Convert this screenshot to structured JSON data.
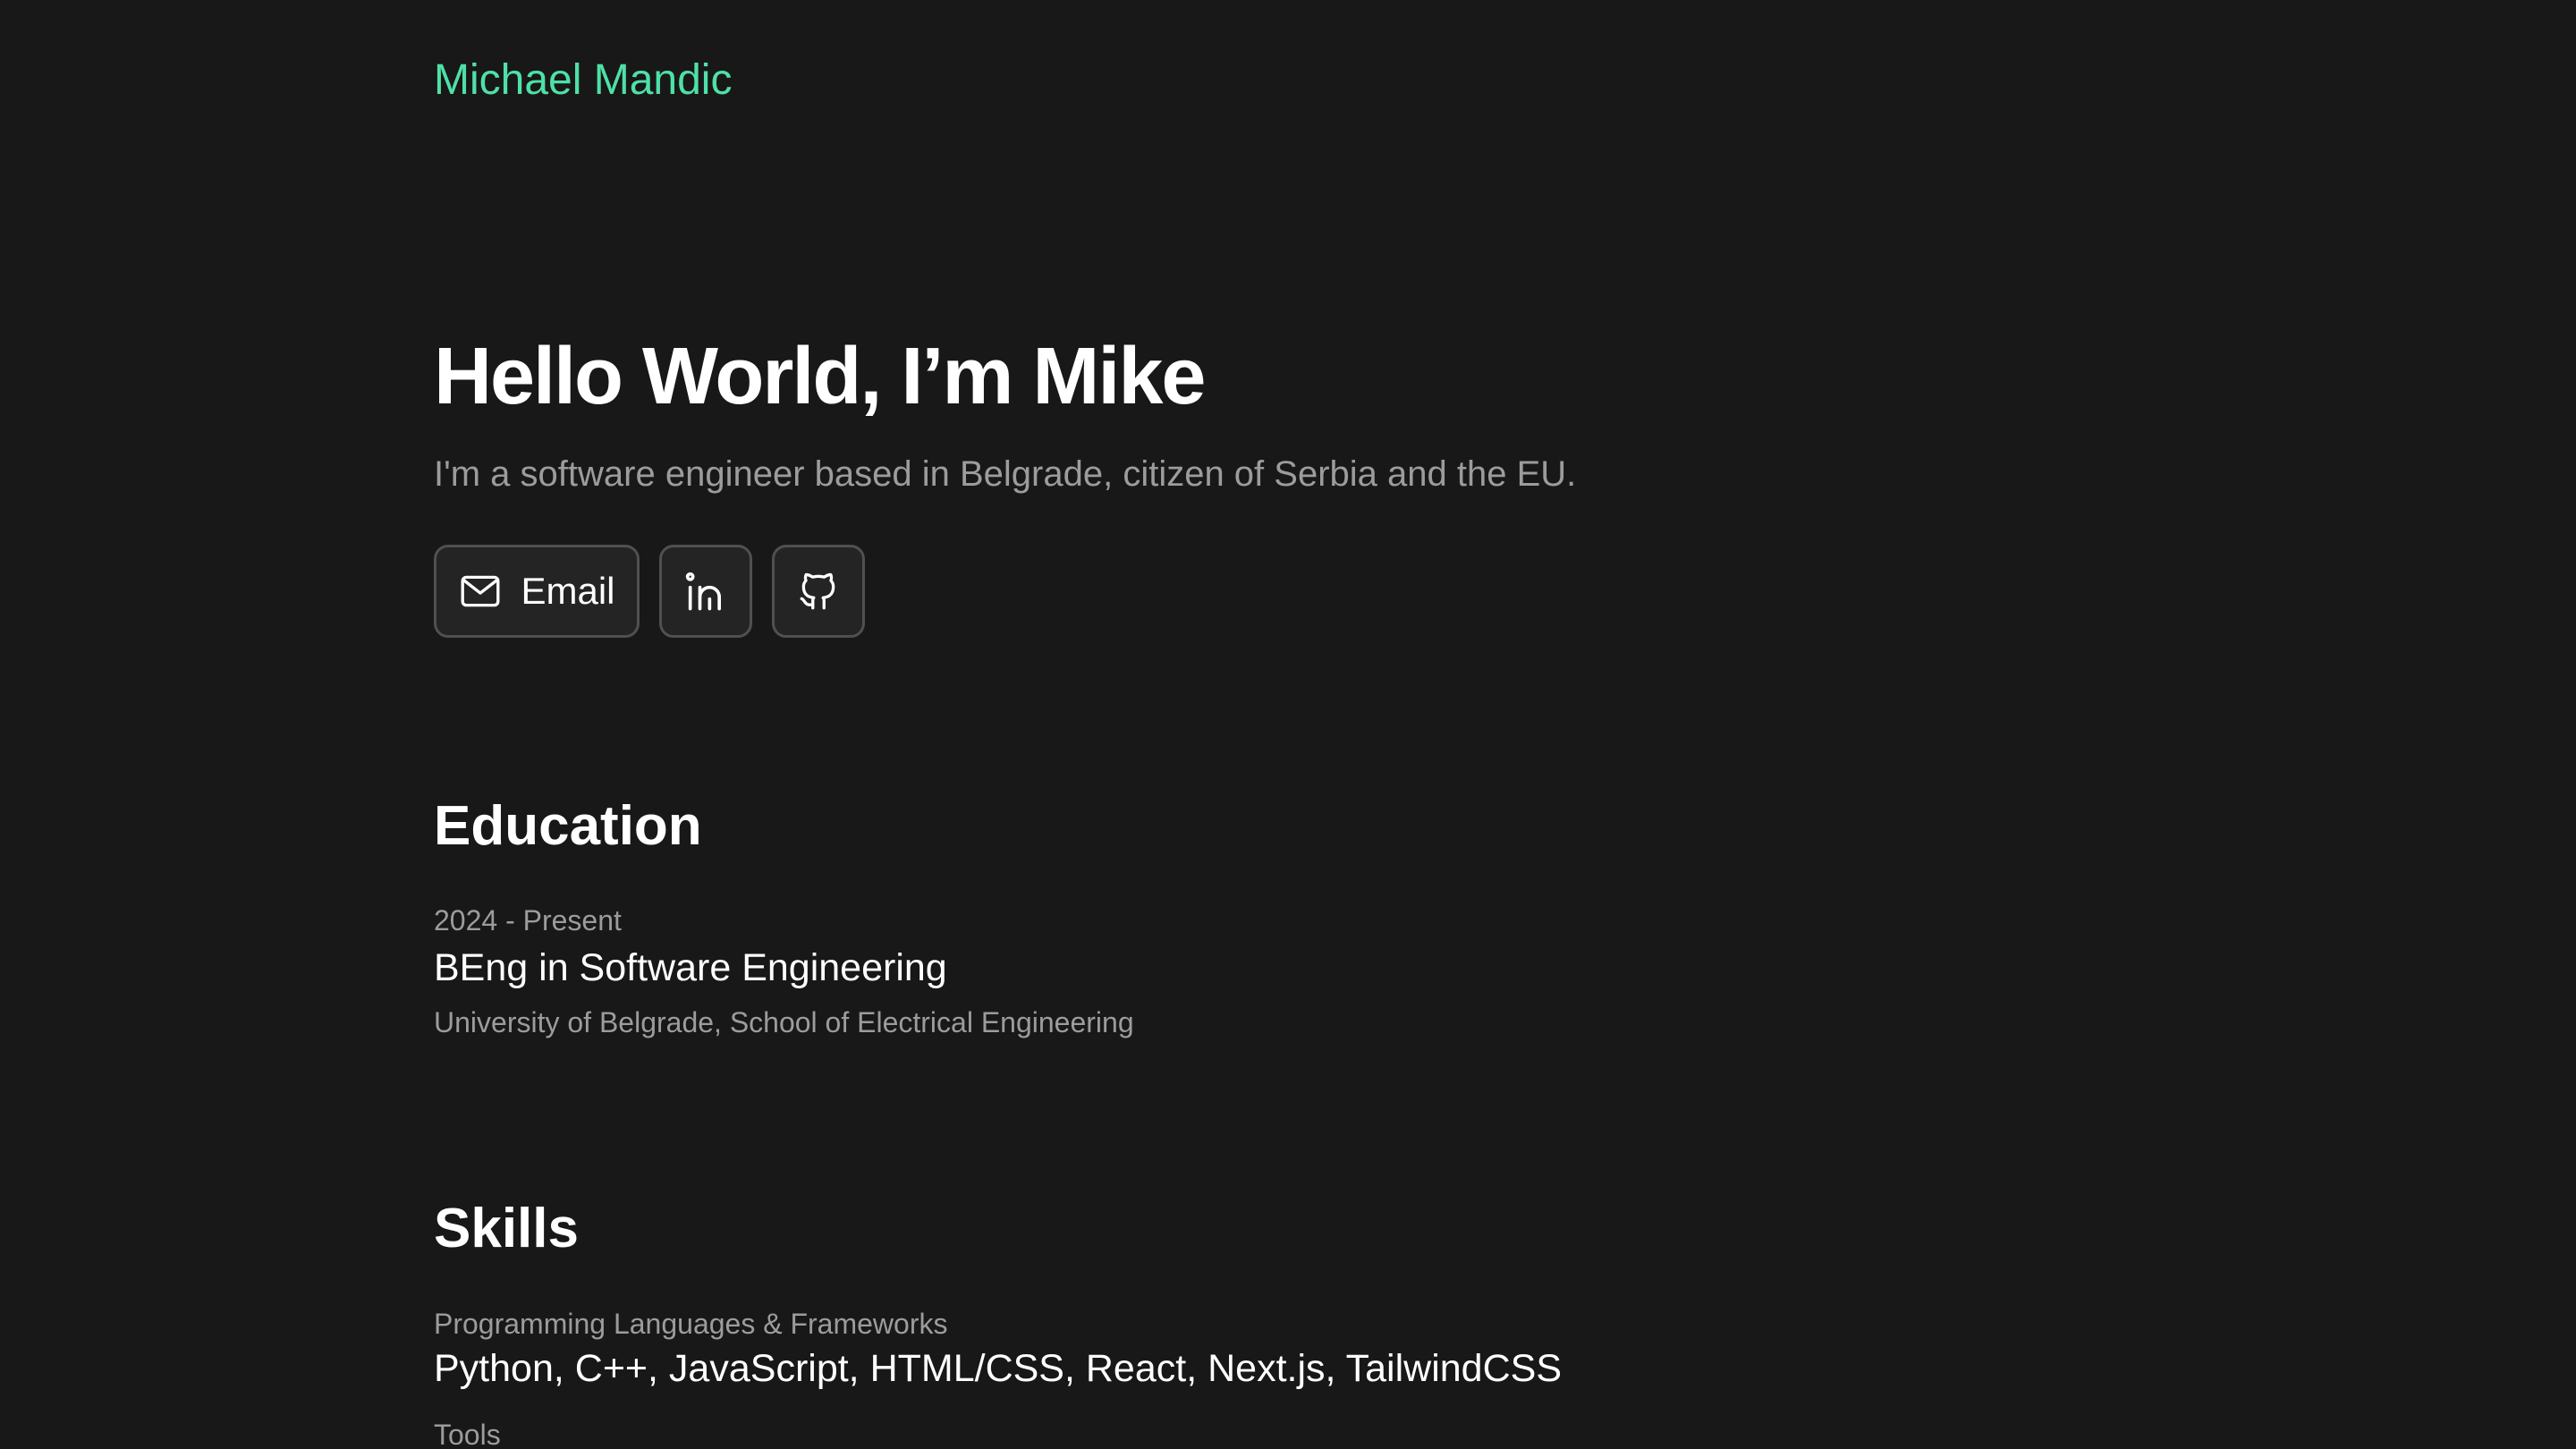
{
  "header": {
    "brand": "Michael Mandic"
  },
  "hero": {
    "title": "Hello World, I’m Mike",
    "subtitle": "I'm a software engineer based in Belgrade, citizen of Serbia and the EU.",
    "buttons": {
      "email_label": "Email",
      "email_icon": "mail-icon",
      "linkedin_icon": "linkedin-icon",
      "github_icon": "github-icon"
    }
  },
  "education": {
    "title": "Education",
    "items": [
      {
        "period": "2024 - Present",
        "degree": "BEng in Software Engineering",
        "institution": "University of Belgrade, School of Electrical Engineering"
      }
    ]
  },
  "skills": {
    "title": "Skills",
    "groups": [
      {
        "label": "Programming Languages & Frameworks",
        "value": "Python, C++, JavaScript, HTML/CSS, React, Next.js, TailwindCSS"
      },
      {
        "label": "Tools",
        "value": ""
      }
    ]
  },
  "colors": {
    "background": "#181818",
    "accent": "#4fe0a7",
    "muted_text": "#9c9c9c",
    "button_border": "#505050"
  }
}
